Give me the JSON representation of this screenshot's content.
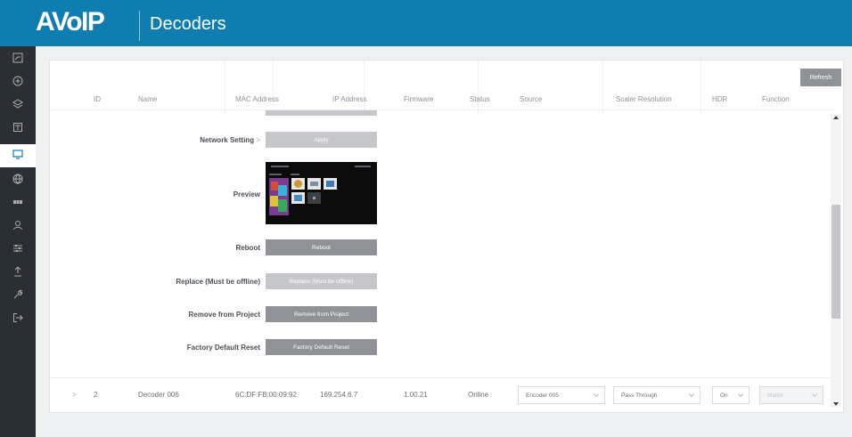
{
  "header": {
    "logo": "AVoIP",
    "title": "Decoders"
  },
  "sidebar": {
    "items": [
      {
        "icon": "dashboard-icon",
        "active": false
      },
      {
        "icon": "plus-circle-icon",
        "active": false
      },
      {
        "icon": "layers-icon",
        "active": false
      },
      {
        "icon": "encoder-icon",
        "active": false
      },
      {
        "icon": "monitor-icon",
        "active": true
      },
      {
        "icon": "globe-icon",
        "active": false
      },
      {
        "icon": "video-wall-icon",
        "active": false
      },
      {
        "icon": "user-icon",
        "active": false
      },
      {
        "icon": "sliders-icon",
        "active": false
      },
      {
        "icon": "upload-icon",
        "active": false
      },
      {
        "icon": "wrench-icon",
        "active": false
      },
      {
        "icon": "logout-icon",
        "active": false
      }
    ]
  },
  "toolbar": {
    "refresh_label": "Refresh"
  },
  "table": {
    "headers": [
      "ID",
      "Name",
      "MAC Address",
      "IP Address",
      "Firmware",
      "Status",
      "Source",
      "Scaler Resolution",
      "HDR",
      "Function"
    ]
  },
  "settings": {
    "network_label": "Network Setting",
    "network_chevron": ">",
    "apply_label": "Apply",
    "preview_label": "Preview",
    "reboot_label": "Reboot",
    "reboot_button": "Reboot",
    "replace_label": "Replace (Must be offline)",
    "replace_button": "Replace (Must be offline)",
    "remove_label": "Remove from Project",
    "remove_button": "Remove from Project",
    "factory_label": "Factory Default Reset",
    "factory_button": "Factory Default Reset"
  },
  "row": {
    "expand": ">",
    "id": "2",
    "name": "Decoder 006",
    "mac": "6C:DF:FB:00:09:92",
    "ip": "169.254.6.7",
    "firmware": "1.00.21",
    "status": "Online",
    "source": "Encoder 005",
    "scaler": "Pass Through",
    "hdr": "On",
    "function": "Matrix"
  }
}
